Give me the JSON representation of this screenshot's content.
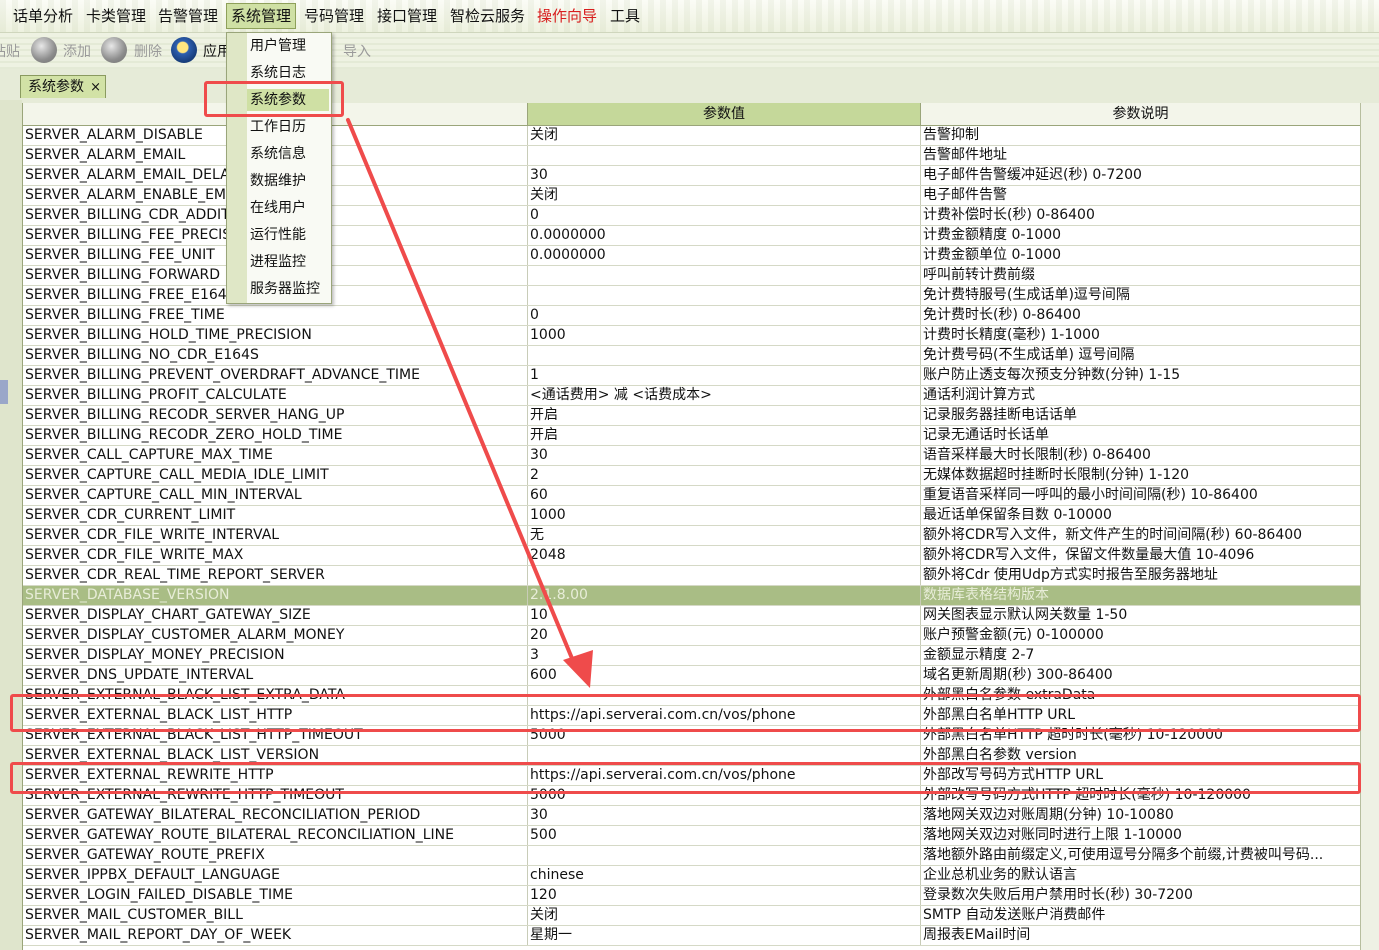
{
  "menu": [
    {
      "name": "menu-cdr-analysis",
      "label": "话单分析"
    },
    {
      "name": "menu-card-management",
      "label": "卡类管理"
    },
    {
      "name": "menu-alarm-management",
      "label": "告警管理"
    },
    {
      "name": "menu-system-management",
      "label": "系统管理"
    },
    {
      "name": "menu-number-management",
      "label": "号码管理"
    },
    {
      "name": "menu-interface-management",
      "label": "接口管理"
    },
    {
      "name": "menu-cloud-service",
      "label": "智检云服务"
    },
    {
      "name": "menu-guide",
      "label": "操作向导"
    },
    {
      "name": "menu-tools",
      "label": "工具"
    }
  ],
  "toolbar": {
    "paste": "粘贴",
    "add": "添加",
    "delete": "删除",
    "apply": "应用",
    "import": "导入"
  },
  "tab": {
    "label": "系统参数",
    "close": "×"
  },
  "dropdown": [
    "用户管理",
    "系统日志",
    "系统参数",
    "工作日历",
    "系统信息",
    "数据维护",
    "在线用户",
    "运行性能",
    "进程监控",
    "服务器监控"
  ],
  "table": {
    "headers": [
      "",
      "参数值",
      "参数说明"
    ],
    "rows": [
      [
        "SERVER_ALARM_DISABLE",
        "关闭",
        "告警抑制"
      ],
      [
        "SERVER_ALARM_EMAIL",
        "",
        "告警邮件地址"
      ],
      [
        "SERVER_ALARM_EMAIL_DELAY",
        "30",
        "电子邮件告警缓冲延迟(秒) 0-7200"
      ],
      [
        "SERVER_ALARM_ENABLE_EMAIL",
        "关闭",
        "电子邮件告警"
      ],
      [
        "SERVER_BILLING_CDR_ADDITION",
        "0",
        "计费补偿时长(秒) 0-86400"
      ],
      [
        "SERVER_BILLING_FEE_PRECISION",
        "0.0000000",
        "计费金额精度 0-1000"
      ],
      [
        "SERVER_BILLING_FEE_UNIT",
        "0.0000000",
        "计费金额单位 0-1000"
      ],
      [
        "SERVER_BILLING_FORWARD",
        "",
        "呼叫前转计费前缀"
      ],
      [
        "SERVER_BILLING_FREE_E164",
        "",
        "免计费特服号(生成话单)逗号间隔"
      ],
      [
        "SERVER_BILLING_FREE_TIME",
        "0",
        "免计费时长(秒) 0-86400"
      ],
      [
        "SERVER_BILLING_HOLD_TIME_PRECISION",
        "1000",
        "计费时长精度(毫秒) 1-1000"
      ],
      [
        "SERVER_BILLING_NO_CDR_E164S",
        "",
        "免计费号码(不生成话单) 逗号间隔"
      ],
      [
        "SERVER_BILLING_PREVENT_OVERDRAFT_ADVANCE_TIME",
        "1",
        "账户防止透支每次预支分钟数(分钟) 1-15"
      ],
      [
        "SERVER_BILLING_PROFIT_CALCULATE",
        "<通话费用> 减 <话费成本>",
        "通话利润计算方式"
      ],
      [
        "SERVER_BILLING_RECODR_SERVER_HANG_UP",
        "开启",
        "记录服务器挂断电话话单"
      ],
      [
        "SERVER_BILLING_RECODR_ZERO_HOLD_TIME",
        "开启",
        "记录无通话时长话单"
      ],
      [
        "SERVER_CALL_CAPTURE_MAX_TIME",
        "30",
        "语音采样最大时长限制(秒) 0-86400"
      ],
      [
        "SERVER_CAPTURE_CALL_MEDIA_IDLE_LIMIT",
        "2",
        "无媒体数据超时挂断时长限制(分钟) 1-120"
      ],
      [
        "SERVER_CAPTURE_CALL_MIN_INTERVAL",
        "60",
        "重复语音采样同一呼叫的最小时间间隔(秒) 10-86400"
      ],
      [
        "SERVER_CDR_CURRENT_LIMIT",
        "1000",
        "最近话单保留条目数 0-10000"
      ],
      [
        "SERVER_CDR_FILE_WRITE_INTERVAL",
        "无",
        "额外将CDR写入文件，新文件产生的时间间隔(秒) 60-86400"
      ],
      [
        "SERVER_CDR_FILE_WRITE_MAX",
        "2048",
        "额外将CDR写入文件，保留文件数量最大值 10-4096"
      ],
      [
        "SERVER_CDR_REAL_TIME_REPORT_SERVER",
        "",
        "额外将Cdr 使用Udp方式实时报告至服务器地址"
      ],
      [
        "SERVER_DATABASE_VERSION",
        "2.1.8.00",
        "数据库表格结构版本"
      ],
      [
        "SERVER_DISPLAY_CHART_GATEWAY_SIZE",
        "10",
        "网关图表显示默认网关数量 1-50"
      ],
      [
        "SERVER_DISPLAY_CUSTOMER_ALARM_MONEY",
        "20",
        "账户预警金额(元) 0-100000"
      ],
      [
        "SERVER_DISPLAY_MONEY_PRECISION",
        "3",
        "金额显示精度 2-7"
      ],
      [
        "SERVER_DNS_UPDATE_INTERVAL",
        "600",
        "域名更新周期(秒) 300-86400"
      ],
      [
        "SERVER_EXTERNAL_BLACK_LIST_EXTRA_DATA",
        "",
        "外部黑白名参数 extraData"
      ],
      [
        "SERVER_EXTERNAL_BLACK_LIST_HTTP",
        "https://api.serverai.com.cn/vos/phone",
        "外部黑白名单HTTP URL"
      ],
      [
        "SERVER_EXTERNAL_BLACK_LIST_HTTP_TIMEOUT",
        "5000",
        "外部黑白名单HTTP 超时时长(毫秒) 10-120000"
      ],
      [
        "SERVER_EXTERNAL_BLACK_LIST_VERSION",
        "",
        "外部黑白名参数 version"
      ],
      [
        "SERVER_EXTERNAL_REWRITE_HTTP",
        "https://api.serverai.com.cn/vos/phone",
        "外部改写号码方式HTTP URL"
      ],
      [
        "SERVER_EXTERNAL_REWRITE_HTTP_TIMEOUT",
        "5000",
        "外部改写号码方式HTTP 超时时长(毫秒) 10-120000"
      ],
      [
        "SERVER_GATEWAY_BILATERAL_RECONCILIATION_PERIOD",
        "30",
        "落地网关双边对账周期(分钟) 10-10080"
      ],
      [
        "SERVER_GATEWAY_ROUTE_BILATERAL_RECONCILIATION_LINE",
        "500",
        "落地网关双边对账同时进行上限 1-10000"
      ],
      [
        "SERVER_GATEWAY_ROUTE_PREFIX",
        "",
        "落地额外路由前缀定义,可使用逗号分隔多个前缀,计费被叫号码..."
      ],
      [
        "SERVER_IPPBX_DEFAULT_LANGUAGE",
        "chinese",
        "企业总机业务的默认语言"
      ],
      [
        "SERVER_LOGIN_FAILED_DISABLE_TIME",
        "120",
        "登录数次失败后用户禁用时长(秒) 30-7200"
      ],
      [
        "SERVER_MAIL_CUSTOMER_BILL",
        "关闭",
        "SMTP 自动发送账户消费邮件"
      ],
      [
        "SERVER_MAIL_REPORT_DAY_OF_WEEK",
        "星期一",
        "周报表EMail时间"
      ]
    ],
    "highlight_row": 23
  },
  "colors": {
    "annotation_red": "#ef4b4b",
    "accent_green": "#cfe0a4",
    "highlight_row": "#a9bd85",
    "guide_red": "#d81e1e"
  }
}
